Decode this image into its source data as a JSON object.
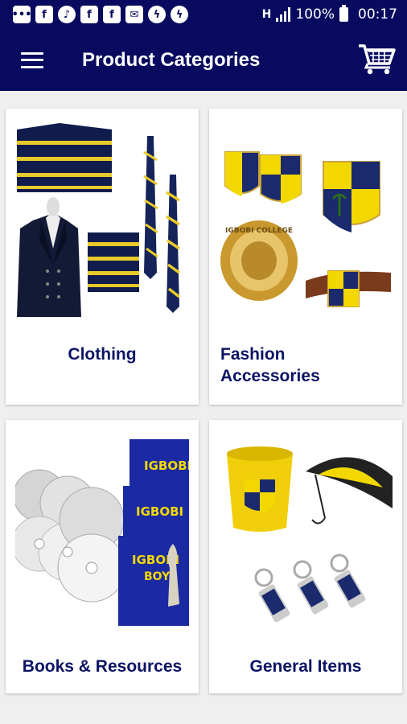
{
  "status_bar": {
    "notification_icons": [
      "message-icon",
      "facebook-icon",
      "music-icon",
      "facebook-icon",
      "facebook-icon",
      "mail-icon",
      "messenger-icon",
      "messenger-icon"
    ],
    "network": "H",
    "battery": "100%",
    "time": "00:17"
  },
  "app_bar": {
    "title": "Product Categories",
    "menu_icon": "hamburger-menu-icon",
    "cart_icon": "shopping-cart-icon"
  },
  "categories": [
    {
      "label": "Clothing"
    },
    {
      "label": "Fashion Accessories"
    },
    {
      "label": "Books & Resources"
    },
    {
      "label": "General Items"
    }
  ],
  "product_image_text": {
    "ring": "IGBOBI COLLEGE",
    "book_title": "IGBOBI",
    "book_subtitle": "BOY"
  },
  "colors": {
    "primary": "#070a5e",
    "label": "#0c1464",
    "gold": "#f2d800",
    "navy": "#1a2a6c"
  }
}
